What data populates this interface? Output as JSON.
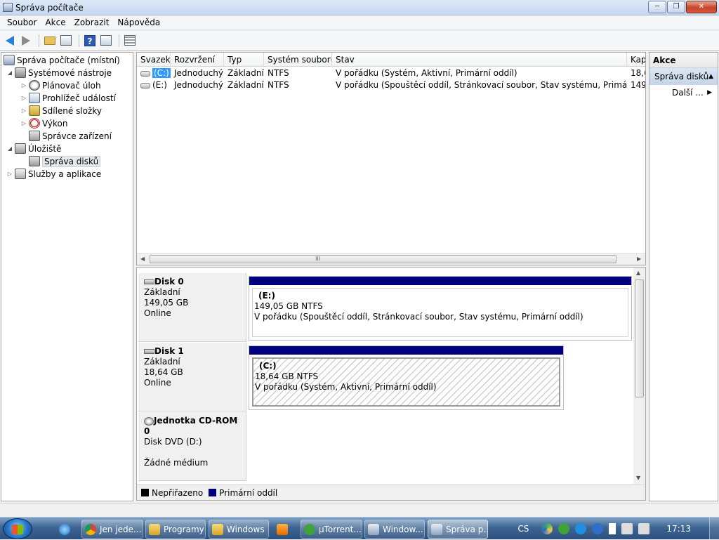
{
  "window": {
    "title": "Správa počítače"
  },
  "menu": [
    "Soubor",
    "Akce",
    "Zobrazit",
    "Nápověda"
  ],
  "tree": [
    {
      "label": "Správa počítače (místní)"
    },
    {
      "label": "Systémové nástroje"
    },
    {
      "label": "Plánovač úloh"
    },
    {
      "label": "Prohlížeč událostí"
    },
    {
      "label": "Sdílené složky"
    },
    {
      "label": "Výkon"
    },
    {
      "label": "Správce zařízení"
    },
    {
      "label": "Úložiště"
    },
    {
      "label": "Správa disků"
    },
    {
      "label": "Služby a aplikace"
    }
  ],
  "volumes": {
    "columns": [
      "Svazek",
      "Rozvržení",
      "Typ",
      "Systém souborů",
      "Stav",
      "Kap"
    ],
    "rows": [
      {
        "name": "(C:)",
        "layout": "Jednoduchý",
        "type": "Základní",
        "fs": "NTFS",
        "status": "V pořádku (Systém, Aktivní, Primární oddíl)",
        "cap": "18,6"
      },
      {
        "name": "(E:)",
        "layout": "Jednoduchý",
        "type": "Základní",
        "fs": "NTFS",
        "status": "V pořádku (Spouštěcí oddíl, Stránkovací soubor, Stav systému, Primární oddíl)",
        "cap": "149,"
      }
    ],
    "scroll_grip": "III"
  },
  "disks": [
    {
      "name": "Disk 0",
      "type": "Základní",
      "size": "149,05 GB",
      "state": "Online",
      "partition": {
        "name": "(E:)",
        "size": "149,05 GB NTFS",
        "status": "V pořádku (Spouštěcí oddíl, Stránkovací soubor, Stav systému, Primární oddíl)"
      }
    },
    {
      "name": "Disk 1",
      "type": "Základní",
      "size": "18,64 GB",
      "state": "Online",
      "partition": {
        "name": "(C:)",
        "size": "18,64 GB NTFS",
        "status": "V pořádku (Systém, Aktivní, Primární oddíl)"
      }
    },
    {
      "name": "Jednotka CD-ROM 0",
      "type": "Disk DVD (D:)",
      "state": "Žádné médium"
    }
  ],
  "legend": {
    "unallocated": "Nepřiřazeno",
    "primary": "Primární oddíl",
    "unallocated_color": "#000000",
    "primary_color": "#00007f"
  },
  "actions": {
    "header": "Akce",
    "section": "Správa disků",
    "more": "Další ..."
  },
  "taskbar": {
    "items": [
      "Jen jede...",
      "Programy",
      "Windows",
      "µTorrent...",
      "Window...",
      "Správa p..."
    ],
    "lang": "CS",
    "clock": "17:13"
  }
}
